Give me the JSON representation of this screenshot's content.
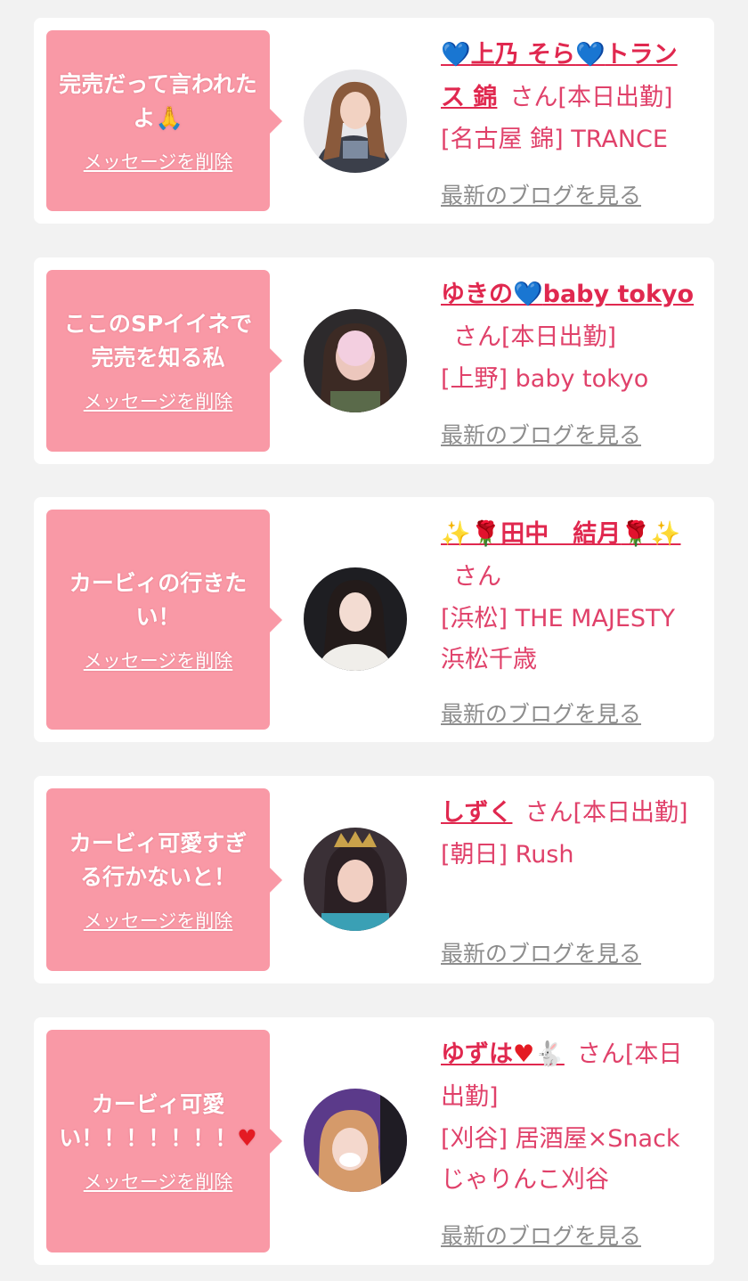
{
  "delete_label": "メッセージを削除",
  "blog_label": "最新のブログを見る",
  "san_suffix": "さん",
  "colors": {
    "background": "#f2f2f2",
    "bubble": "#f999a6",
    "name": "#e0284f",
    "text": "#e0416a",
    "blog_link": "#8d8d8d"
  },
  "cards": [
    {
      "message": "完売だって言われたよ",
      "message_icon": "🙏",
      "name_prefix_icon": "💙",
      "name": "上乃 そら",
      "name_mid_icon": "💙",
      "name_suffix": "トランス 錦",
      "status": "[本日出勤]",
      "shop_lines": [
        "[名古屋 錦] TRANCE"
      ],
      "avatar_icon": "woman-long-hair-photo"
    },
    {
      "message": "ここのSPイイネで完売を知る私",
      "name": "ゆきの",
      "name_mid_icon": "💙",
      "name_suffix": "baby tokyo",
      "status": "[本日出勤]",
      "shop_lines": [
        "[上野] baby tokyo"
      ],
      "avatar_icon": "woman-face-blurred-photo"
    },
    {
      "message": "カービィの行きたい！",
      "name_prefix_icon": "✨🌹",
      "name": "田中　結月",
      "name_mid_icon": "🌹✨",
      "status": "",
      "shop_lines": [
        "[浜松] THE MAJESTY",
        "浜松千歳"
      ],
      "avatar_icon": "woman-dark-hair-photo"
    },
    {
      "message": "カービィ可愛すぎる行かないと！",
      "name": "しずく",
      "status": "[本日出勤]",
      "shop_lines": [
        "[朝日] Rush"
      ],
      "avatar_icon": "woman-crown-photo"
    },
    {
      "message": "カービィ可愛い！！！！！！！",
      "message_icon": "♥",
      "name": "ゆずは",
      "name_mid_icon": "♥🐇",
      "status": "[本日出勤]",
      "shop_lines": [
        "[刈谷] 居酒屋×Snack",
        "じゃりんこ刈谷"
      ],
      "avatar_icon": "woman-masked-photo"
    }
  ]
}
